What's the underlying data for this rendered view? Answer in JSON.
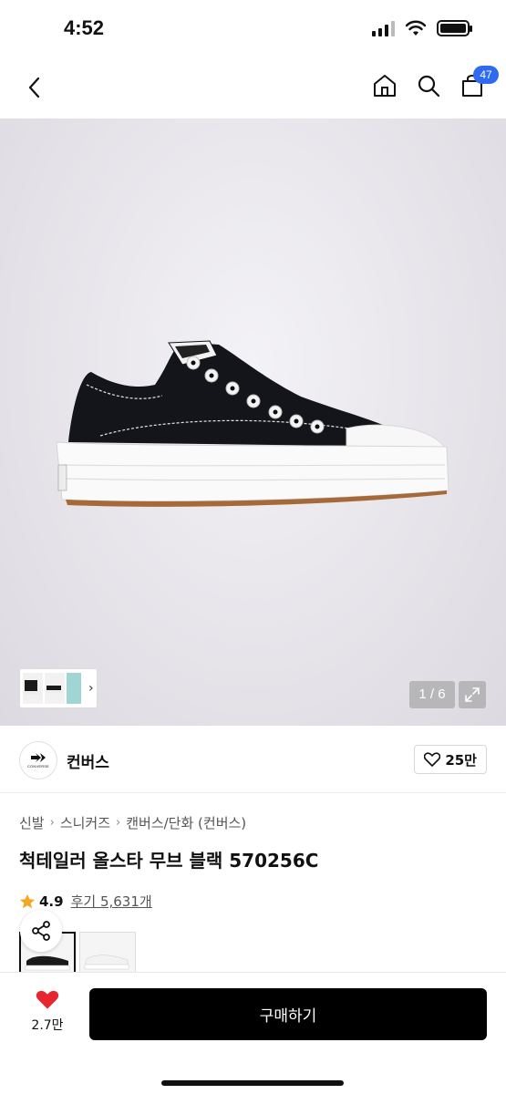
{
  "status_bar": {
    "time": "4:52"
  },
  "nav": {
    "cart_count": "47"
  },
  "gallery": {
    "page_indicator": "1 / 6"
  },
  "brand": {
    "name": "컨버스",
    "logo_text": "CONVERSE",
    "like_count": "25만"
  },
  "breadcrumb": [
    "신발",
    "스니커즈",
    "캔버스/단화 (컨버스)"
  ],
  "product": {
    "title": "척테일러 올스타 무브 블랙 570256C",
    "rating": "4.9",
    "reviews_label": "후기 5,631개"
  },
  "bottom_bar": {
    "wish_count": "2.7만",
    "buy_label": "구매하기"
  },
  "colors": {
    "accent_badge": "#2f6bf0",
    "wish_heart": "#e8262f",
    "star": "#f5a623",
    "buy_button": "#000000"
  }
}
